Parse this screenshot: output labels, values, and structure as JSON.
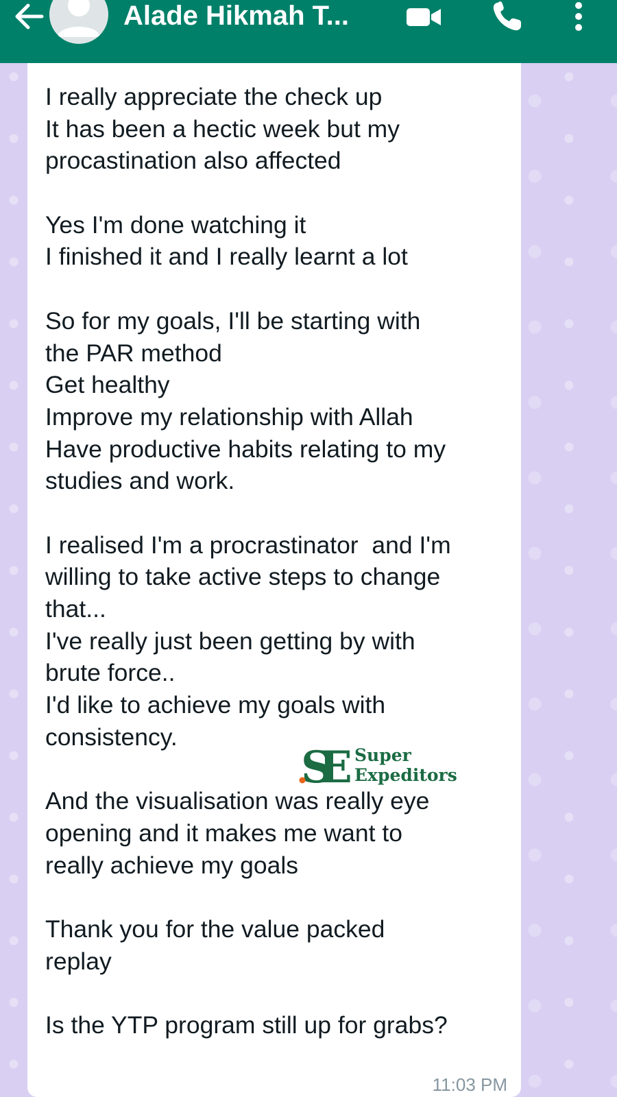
{
  "header": {
    "contact_name": "Alade Hikmah T...",
    "icons": [
      "back-arrow-icon",
      "avatar-placeholder-icon",
      "video-camera-icon",
      "phone-icon",
      "more-vert-icon"
    ],
    "background_color": "#008069"
  },
  "message": {
    "lines": [
      "I really appreciate the check up",
      "It has been a hectic week but my",
      "procastination also affected",
      "",
      "Yes I'm done watching it",
      "I finished it and I really learnt a lot",
      "",
      "So for my goals, I'll be starting with",
      "the PAR method",
      "Get healthy",
      "Improve my relationship with Allah",
      "Have productive habits relating to my",
      "studies and work.",
      "",
      "I realised I'm a procrastinator  and I'm",
      "willing to take active steps to change",
      "that...",
      "I've really just been getting by with",
      "brute force..",
      "I'd like to achieve my goals with",
      "consistency.",
      "",
      "And the visualisation was really eye",
      "opening and it makes me want to",
      "really achieve my goals",
      "",
      "Thank you for the value packed",
      "replay",
      "",
      "Is the YTP program still up for grabs?"
    ],
    "timestamp": "11:03 PM"
  },
  "watermark": {
    "line1": "Super",
    "line2": "Expeditors",
    "monogram": "SE",
    "color": "#1b6b43",
    "dot_color": "#e8641b"
  },
  "chat_background_color": "#d8cff2"
}
